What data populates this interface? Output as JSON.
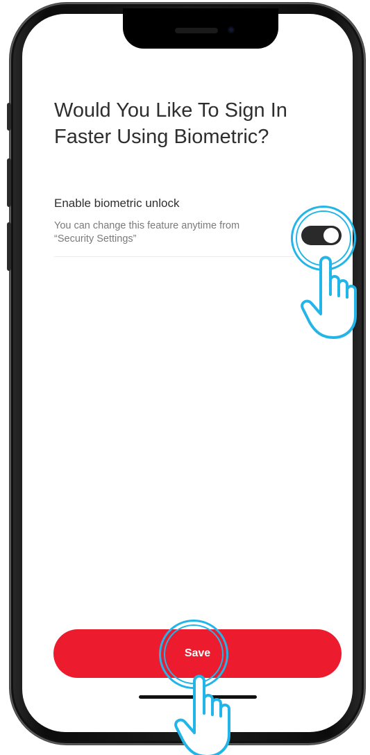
{
  "screen": {
    "title": "Would You Like To Sign In Faster Using Biometric?",
    "biometric_option": {
      "label": "Enable biometric unlock",
      "description": "You can change this feature anytime from “Security Settings”",
      "toggle_state": "on"
    },
    "save_button": {
      "label": "Save",
      "color": "#ec1c2e"
    }
  },
  "annotations": {
    "tap_highlight_color": "#23b5e8",
    "icons": [
      "tap-hand-icon"
    ]
  }
}
